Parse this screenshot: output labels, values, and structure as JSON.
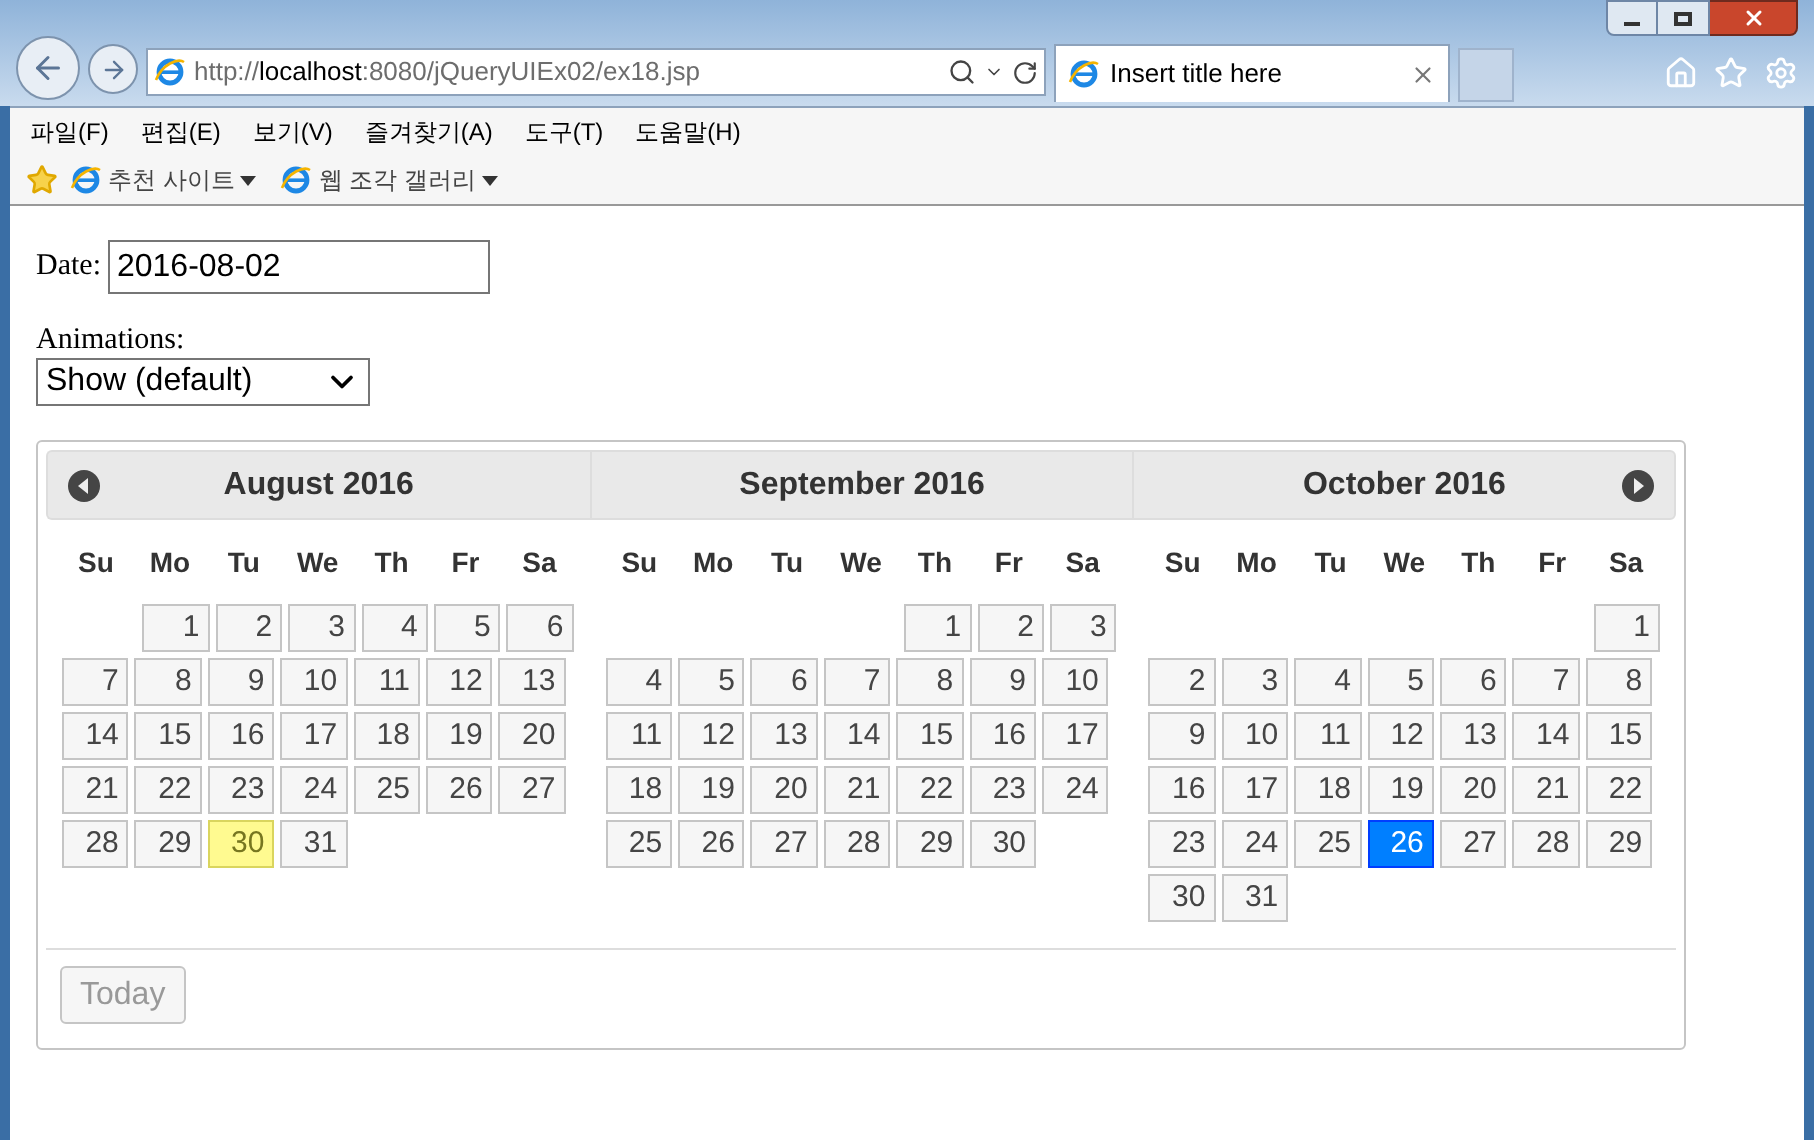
{
  "browser": {
    "address_scheme": "http://",
    "address_host": "localhost",
    "address_path": ":8080/jQueryUIEx02/ex18.jsp",
    "tab_title": "Insert title here"
  },
  "menu": [
    "파일(F)",
    "편집(E)",
    "보기(V)",
    "즐겨찾기(A)",
    "도구(T)",
    "도움말(H)"
  ],
  "favorites": [
    "추천 사이트",
    "웹 조각 갤러리"
  ],
  "date_field": {
    "label": "Date:",
    "value": "2016-08-02"
  },
  "animations": {
    "label": "Animations:",
    "value": "Show (default)"
  },
  "months": [
    {
      "title": "August 2016",
      "weekdays": [
        "Su",
        "Mo",
        "Tu",
        "We",
        "Th",
        "Fr",
        "Sa"
      ],
      "weeks": [
        {
          "kind": "leading",
          "days": [
            {
              "label": "1",
              "selected": false,
              "today": false
            },
            {
              "label": "2",
              "selected": false,
              "today": false
            },
            {
              "label": "3",
              "selected": false,
              "today": false
            },
            {
              "label": "4",
              "selected": false,
              "today": false
            },
            {
              "label": "5",
              "selected": false,
              "today": false
            },
            {
              "label": "6",
              "selected": false,
              "today": false
            }
          ]
        },
        {
          "kind": "full",
          "days": [
            {
              "label": "7",
              "selected": false,
              "today": false
            },
            {
              "label": "8",
              "selected": false,
              "today": false
            },
            {
              "label": "9",
              "selected": false,
              "today": false
            },
            {
              "label": "10",
              "selected": false,
              "today": false
            },
            {
              "label": "11",
              "selected": false,
              "today": false
            },
            {
              "label": "12",
              "selected": false,
              "today": false
            },
            {
              "label": "13",
              "selected": false,
              "today": false
            }
          ]
        },
        {
          "kind": "full",
          "days": [
            {
              "label": "14",
              "selected": false,
              "today": false
            },
            {
              "label": "15",
              "selected": false,
              "today": false
            },
            {
              "label": "16",
              "selected": false,
              "today": false
            },
            {
              "label": "17",
              "selected": false,
              "today": false
            },
            {
              "label": "18",
              "selected": false,
              "today": false
            },
            {
              "label": "19",
              "selected": false,
              "today": false
            },
            {
              "label": "20",
              "selected": false,
              "today": false
            }
          ]
        },
        {
          "kind": "full",
          "days": [
            {
              "label": "21",
              "selected": false,
              "today": false
            },
            {
              "label": "22",
              "selected": false,
              "today": false
            },
            {
              "label": "23",
              "selected": false,
              "today": false
            },
            {
              "label": "24",
              "selected": false,
              "today": false
            },
            {
              "label": "25",
              "selected": false,
              "today": false
            },
            {
              "label": "26",
              "selected": false,
              "today": false
            },
            {
              "label": "27",
              "selected": false,
              "today": false
            }
          ]
        },
        {
          "kind": "trailing",
          "days": [
            {
              "label": "28",
              "selected": false,
              "today": false
            },
            {
              "label": "29",
              "selected": false,
              "today": false
            },
            {
              "label": "30",
              "selected": false,
              "today": true
            },
            {
              "label": "31",
              "selected": false,
              "today": false
            }
          ]
        }
      ]
    },
    {
      "title": "September 2016",
      "weekdays": [
        "Su",
        "Mo",
        "Tu",
        "We",
        "Th",
        "Fr",
        "Sa"
      ],
      "weeks": [
        {
          "kind": "leading",
          "days": [
            {
              "label": "1",
              "selected": false,
              "today": false
            },
            {
              "label": "2",
              "selected": false,
              "today": false
            },
            {
              "label": "3",
              "selected": false,
              "today": false
            }
          ]
        },
        {
          "kind": "full",
          "days": [
            {
              "label": "4",
              "selected": false,
              "today": false
            },
            {
              "label": "5",
              "selected": false,
              "today": false
            },
            {
              "label": "6",
              "selected": false,
              "today": false
            },
            {
              "label": "7",
              "selected": false,
              "today": false
            },
            {
              "label": "8",
              "selected": false,
              "today": false
            },
            {
              "label": "9",
              "selected": false,
              "today": false
            },
            {
              "label": "10",
              "selected": false,
              "today": false
            }
          ]
        },
        {
          "kind": "full",
          "days": [
            {
              "label": "11",
              "selected": false,
              "today": false
            },
            {
              "label": "12",
              "selected": false,
              "today": false
            },
            {
              "label": "13",
              "selected": false,
              "today": false
            },
            {
              "label": "14",
              "selected": false,
              "today": false
            },
            {
              "label": "15",
              "selected": false,
              "today": false
            },
            {
              "label": "16",
              "selected": false,
              "today": false
            },
            {
              "label": "17",
              "selected": false,
              "today": false
            }
          ]
        },
        {
          "kind": "full",
          "days": [
            {
              "label": "18",
              "selected": false,
              "today": false
            },
            {
              "label": "19",
              "selected": false,
              "today": false
            },
            {
              "label": "20",
              "selected": false,
              "today": false
            },
            {
              "label": "21",
              "selected": false,
              "today": false
            },
            {
              "label": "22",
              "selected": false,
              "today": false
            },
            {
              "label": "23",
              "selected": false,
              "today": false
            },
            {
              "label": "24",
              "selected": false,
              "today": false
            }
          ]
        },
        {
          "kind": "trailing",
          "days": [
            {
              "label": "25",
              "selected": false,
              "today": false
            },
            {
              "label": "26",
              "selected": false,
              "today": false
            },
            {
              "label": "27",
              "selected": false,
              "today": false
            },
            {
              "label": "28",
              "selected": false,
              "today": false
            },
            {
              "label": "29",
              "selected": false,
              "today": false
            },
            {
              "label": "30",
              "selected": false,
              "today": false
            }
          ]
        }
      ]
    },
    {
      "title": "October 2016",
      "weekdays": [
        "Su",
        "Mo",
        "Tu",
        "We",
        "Th",
        "Fr",
        "Sa"
      ],
      "weeks": [
        {
          "kind": "leading",
          "days": [
            {
              "label": "1",
              "selected": false,
              "today": false
            }
          ]
        },
        {
          "kind": "full",
          "days": [
            {
              "label": "2",
              "selected": false,
              "today": false
            },
            {
              "label": "3",
              "selected": false,
              "today": false
            },
            {
              "label": "4",
              "selected": false,
              "today": false
            },
            {
              "label": "5",
              "selected": false,
              "today": false
            },
            {
              "label": "6",
              "selected": false,
              "today": false
            },
            {
              "label": "7",
              "selected": false,
              "today": false
            },
            {
              "label": "8",
              "selected": false,
              "today": false
            }
          ]
        },
        {
          "kind": "full",
          "days": [
            {
              "label": "9",
              "selected": false,
              "today": false
            },
            {
              "label": "10",
              "selected": false,
              "today": false
            },
            {
              "label": "11",
              "selected": false,
              "today": false
            },
            {
              "label": "12",
              "selected": false,
              "today": false
            },
            {
              "label": "13",
              "selected": false,
              "today": false
            },
            {
              "label": "14",
              "selected": false,
              "today": false
            },
            {
              "label": "15",
              "selected": false,
              "today": false
            }
          ]
        },
        {
          "kind": "full",
          "days": [
            {
              "label": "16",
              "selected": false,
              "today": false
            },
            {
              "label": "17",
              "selected": false,
              "today": false
            },
            {
              "label": "18",
              "selected": false,
              "today": false
            },
            {
              "label": "19",
              "selected": false,
              "today": false
            },
            {
              "label": "20",
              "selected": false,
              "today": false
            },
            {
              "label": "21",
              "selected": false,
              "today": false
            },
            {
              "label": "22",
              "selected": false,
              "today": false
            }
          ]
        },
        {
          "kind": "full",
          "days": [
            {
              "label": "23",
              "selected": false,
              "today": false
            },
            {
              "label": "24",
              "selected": false,
              "today": false
            },
            {
              "label": "25",
              "selected": false,
              "today": false
            },
            {
              "label": "26",
              "selected": true,
              "today": false
            },
            {
              "label": "27",
              "selected": false,
              "today": false
            },
            {
              "label": "28",
              "selected": false,
              "today": false
            },
            {
              "label": "29",
              "selected": false,
              "today": false
            }
          ]
        },
        {
          "kind": "trailing",
          "days": [
            {
              "label": "30",
              "selected": false,
              "today": false
            },
            {
              "label": "31",
              "selected": false,
              "today": false
            }
          ]
        }
      ]
    }
  ],
  "today_button": "Today"
}
